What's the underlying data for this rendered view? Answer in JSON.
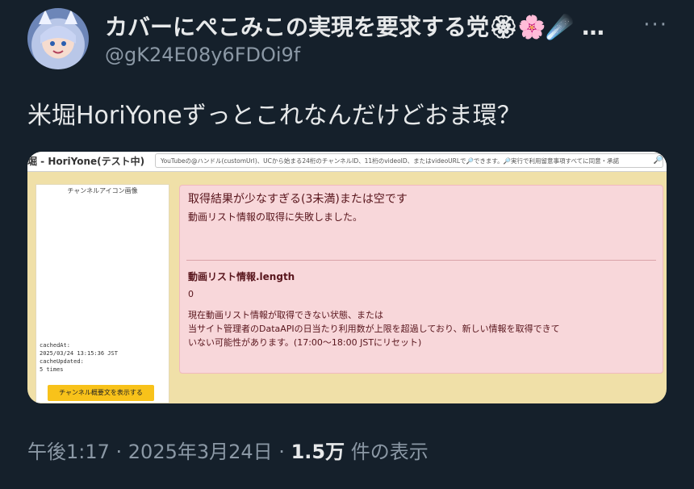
{
  "author": {
    "display_name": "カバーにぺこみこの実現を要求する党",
    "emoji_suffix": "🏵🌸☄️ …",
    "handle": "@gK24E08y6FDOi9f"
  },
  "more_label": "···",
  "tweet": {
    "text": "米堀HoriYoneずっとこれなんだけどおま環？"
  },
  "embedded_screenshot": {
    "site_title": "堀 - HoriYone(テスト中)",
    "search_placeholder": "YouTubeの@ハンドル(customUrl)、UCから始まる24桁のチャンネルID、11桁のvideoID、またはvideoURLで🔎できます。🔎実行で利用留意事項すべてに同意・承諾",
    "search_icon": "magnifier-icon",
    "icon_caption": "チャンネルアイコン画像",
    "cache_info": {
      "cached_at_label": "cachedAt:",
      "cached_at_value": "2025/03/24 13:15:36 JST",
      "cache_updated_label": "cacheUpdated:",
      "cache_updated_value": "5 times"
    },
    "summary_button": "チャンネル概要文を表示する",
    "alert": {
      "title": "取得結果が少なすぎる(3未満)または空です",
      "subtitle": "動画リスト情報の取得に失敗しました。",
      "label": "動画リスト情報.length",
      "value": "0",
      "body_line1": "現在動画リスト情報が取得できない状態、または",
      "body_line2": "当サイト管理者のDataAPIの日当たり利用数が上限を超過しており、新しい情報を取得できて",
      "body_line3": "いない可能性があります。(17:00〜18:00 JSTにリセット)"
    }
  },
  "meta": {
    "timestamp": "午後1:17 · 2025年3月24日 · ",
    "views_count": "1.5万",
    "views_label": " 件の表示"
  }
}
